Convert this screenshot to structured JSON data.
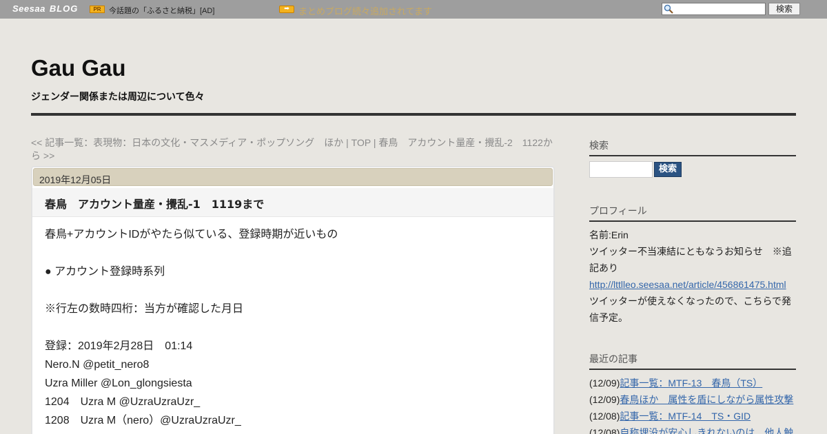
{
  "topbar": {
    "logo_seesaa": "Seesaa",
    "logo_blog": "BLOG",
    "pr_badge": "PR",
    "pr_text": "今話題の「ふるさと納税」[AD]",
    "news_link": "まとめブログ続々追加されてます",
    "search_button": "検索"
  },
  "header": {
    "title": "Gau Gau",
    "description": "ジェンダー関係または周辺について色々"
  },
  "nav": {
    "text": "<< 記事一覧：表現物：日本の文化・マスメディア・ポップソング　ほか | TOP | 春鳥　アカウント量産・攪乱-2　1122から >>"
  },
  "post": {
    "date": "2019年12月05日",
    "title": "春鳥　アカウント量産・攪乱-1　1119まで",
    "body": [
      "春鳥+アカウントIDがやたら似ている、登録時期が近いもの",
      "● アカウント登録時系列",
      "※行左の数時四桁：当方が確認した月日",
      "登録：2019年2月28日　01:14",
      "Nero.N @petit_nero8",
      "Uzra Miller @Lon_glongsiesta",
      "1204　Uzra M @UzraUzraUzr_",
      "1208　Uzra M（nero）@UzraUzraUzr_"
    ]
  },
  "sidebar": {
    "search_heading": "検索",
    "search_button": "検索",
    "profile_heading": "プロフィール",
    "profile_name": "名前:Erin",
    "profile_notice": "ツイッター不当凍結にともなうお知らせ　※追記あり",
    "profile_link": "http://lttlleo.seesaa.net/article/456861475.html",
    "profile_note": "ツイッターが使えなくなったので、こちらで発信予定。",
    "recent_heading": "最近の記事",
    "recent": [
      {
        "date": "(12/09)",
        "title": "記事一覧：MTF-13　春鳥（TS）"
      },
      {
        "date": "(12/09)",
        "title": "春鳥ほか　属性を盾にしながら属性攻撃"
      },
      {
        "date": "(12/08)",
        "title": "記事一覧：MTF-14　TS・GID"
      },
      {
        "date": "(12/08)",
        "title": "自称埋没が安心しきれないのは　他人触"
      }
    ]
  }
}
